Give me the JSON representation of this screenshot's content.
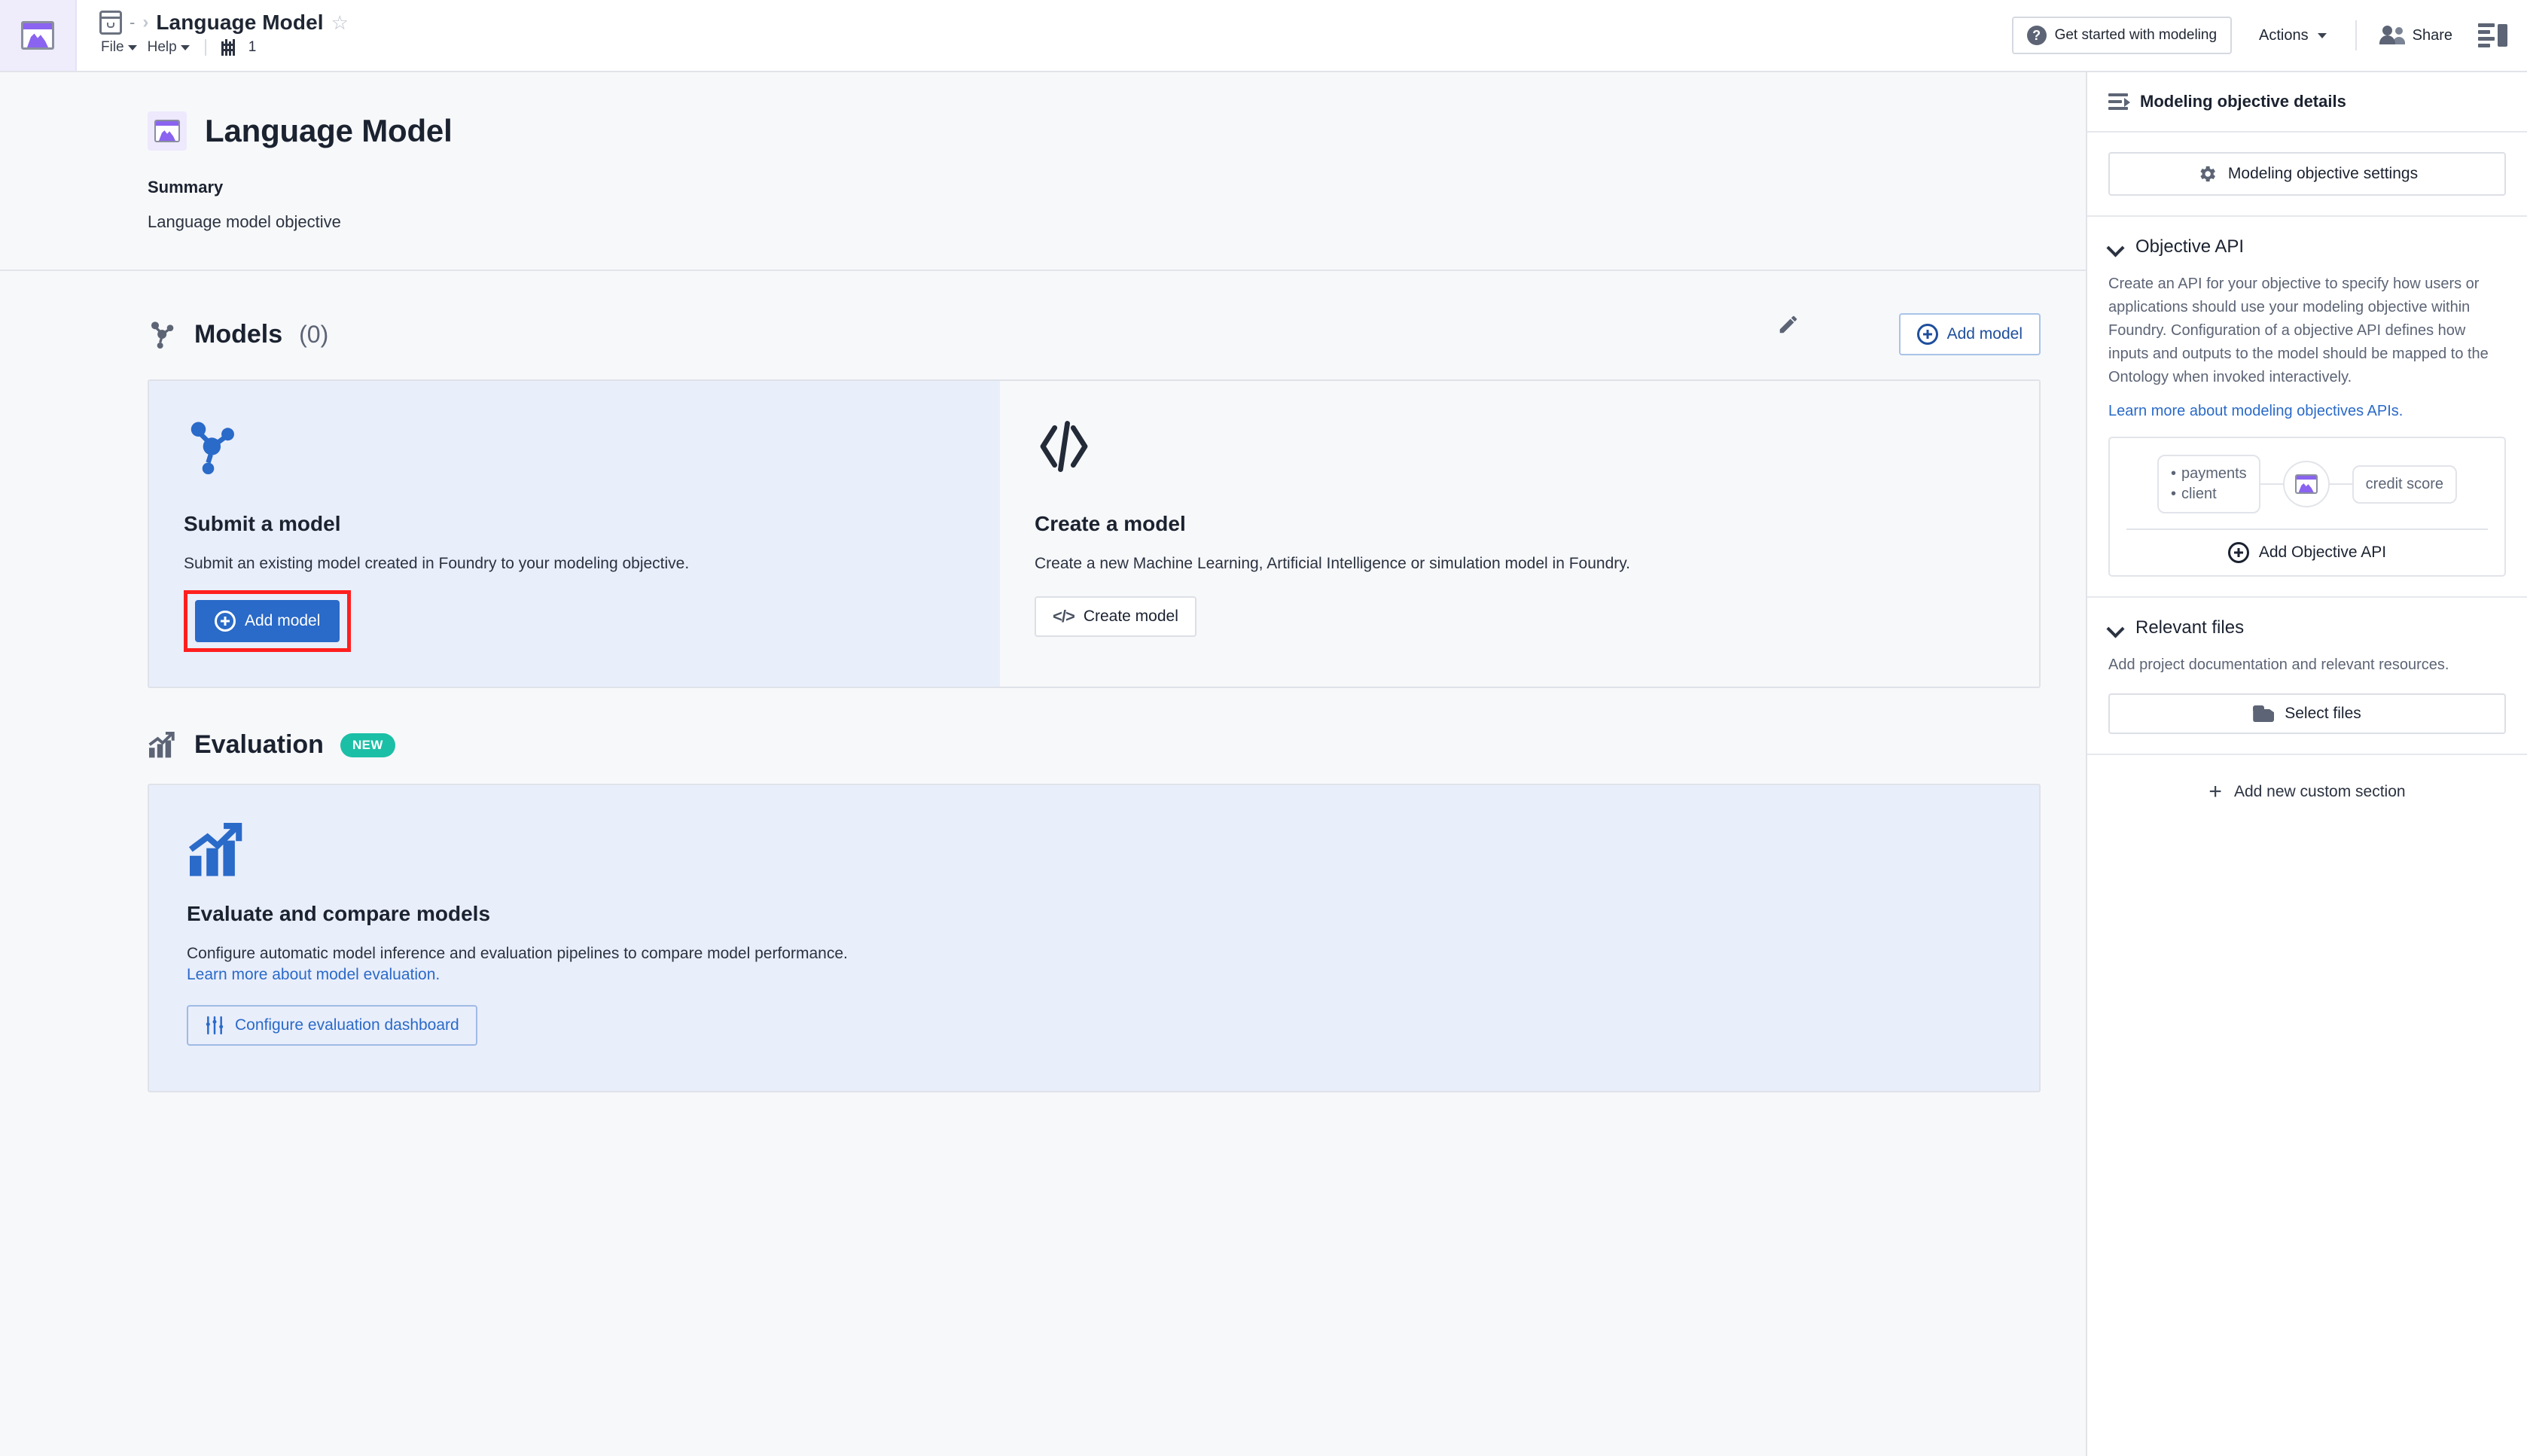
{
  "topbar": {
    "app_icon": "mountain-chart-icon",
    "breadcrumb": {
      "box_icon": "project-box-icon",
      "dash": "-",
      "separator": "›",
      "title": "Language Model",
      "star_icon": "star-outline-icon"
    },
    "menus": [
      {
        "label": "File"
      },
      {
        "label": "Help"
      }
    ],
    "grid_icon": "building-grid-icon",
    "grid_count": "1",
    "get_started_label": "Get started with modeling",
    "help_icon": "question-circle-icon",
    "actions_label": "Actions",
    "share_label": "Share",
    "share_icon": "people-icon",
    "panel_toggle_icon": "panel-toggle-icon"
  },
  "hero": {
    "icon": "mountain-chart-icon",
    "title": "Language Model",
    "summary_label": "Summary",
    "summary_text": "Language model objective",
    "edit_icon": "pencil-edit-icon"
  },
  "models": {
    "icon": "model-graph-icon",
    "title": "Models",
    "count": "(0)",
    "add_model_label": "Add model",
    "add_model_icon": "circle-plus-icon",
    "cards": [
      {
        "icon": "model-graph-icon",
        "title": "Submit a model",
        "desc": "Submit an existing model created in Foundry to your modeling objective.",
        "button_label": "Add model",
        "button_icon": "circle-plus-icon",
        "highlighted": true
      },
      {
        "icon": "code-brackets-icon",
        "title": "Create a model",
        "desc": "Create a new Machine Learning, Artificial Intelligence or simulation model in Foundry.",
        "button_label": "Create model",
        "button_icon": "code-brackets-icon",
        "highlighted": false
      }
    ]
  },
  "evaluation": {
    "icon": "chart-trend-icon",
    "title": "Evaluation",
    "badge": "NEW",
    "card": {
      "icon": "chart-trend-icon",
      "title": "Evaluate and compare models",
      "desc": "Configure automatic model inference and evaluation pipelines to compare model performance.",
      "link": "Learn more about model evaluation.",
      "button_label": "Configure evaluation dashboard",
      "button_icon": "sliders-icon"
    }
  },
  "sidebar": {
    "header": {
      "icon": "details-panel-icon",
      "title": "Modeling objective details"
    },
    "settings_button": {
      "icon": "gear-icon",
      "label": "Modeling objective settings"
    },
    "objective_api": {
      "chevron_icon": "chevron-down-icon",
      "title": "Objective API",
      "desc": "Create an API for your objective to specify how users or applications should use your modeling objective within Foundry. Configuration of a objective API defines how inputs and outputs to the model should be mapped to the Ontology when invoked interactively.",
      "link": "Learn more about modeling objectives APIs.",
      "diagram": {
        "inputs": [
          "payments",
          "client"
        ],
        "node_icon": "mountain-chart-icon",
        "output": "credit score"
      },
      "add_button_label": "Add Objective API",
      "add_button_icon": "circle-plus-icon"
    },
    "relevant_files": {
      "chevron_icon": "chevron-down-icon",
      "title": "Relevant files",
      "desc": "Add project documentation and relevant resources.",
      "button_label": "Select files",
      "button_icon": "folder-icon"
    },
    "add_custom_section": {
      "icon": "plus-icon",
      "label": "Add new custom section"
    }
  },
  "colors": {
    "accent_blue": "#2a6ac8",
    "page_bg": "#f7f8fa",
    "card_bg": "#e9eefb",
    "badge_teal": "#1bbfa6",
    "purple": "#8a63f0",
    "highlight_red": "#ff1f1f"
  }
}
